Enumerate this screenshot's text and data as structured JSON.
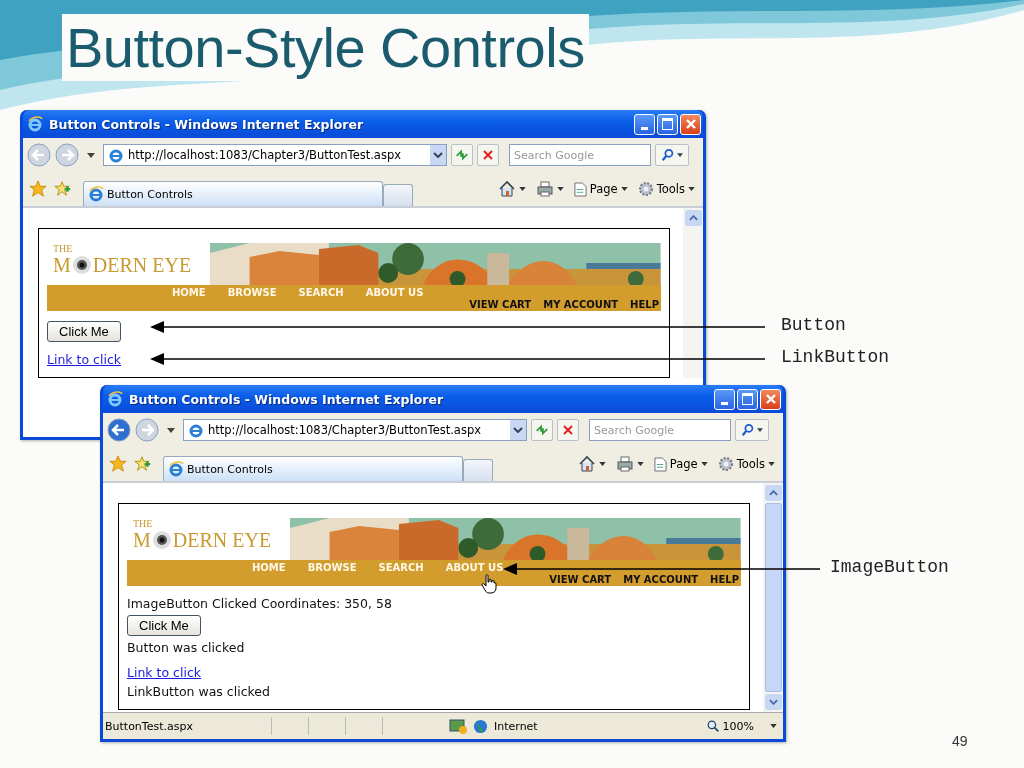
{
  "slide": {
    "title": "Button-Style Controls",
    "page_number": "49"
  },
  "windows": [
    {
      "title": "Button Controls - Windows Internet Explorer",
      "address": "http://localhost:1083/Chapter3/ButtonTest.aspx",
      "search": {
        "placeholder": "Search Google"
      },
      "tab": "Button Controls",
      "commands": [
        "Page",
        "Tools"
      ],
      "back_enabled": false,
      "cursor": false,
      "banner": {
        "logo_top": "THE",
        "logo_parts": [
          "M",
          "DERN EYE"
        ],
        "main_nav": [
          "HOME",
          "BROWSE",
          "SEARCH",
          "ABOUT US"
        ],
        "account_nav": [
          "VIEW CART",
          "MY ACCOUNT",
          "HELP"
        ]
      },
      "content": [
        {
          "kind": "button",
          "text": "Click Me"
        },
        {
          "kind": "link",
          "text": "Link to click"
        }
      ]
    },
    {
      "title": "Button Controls - Windows Internet Explorer",
      "address": "http://localhost:1083/Chapter3/ButtonTest.aspx",
      "search": {
        "placeholder": "Search Google"
      },
      "tab": "Button Controls",
      "commands": [
        "Page",
        "Tools"
      ],
      "back_enabled": true,
      "cursor": true,
      "banner": {
        "logo_top": "THE",
        "logo_parts": [
          "M",
          "DERN EYE"
        ],
        "main_nav": [
          "HOME",
          "BROWSE",
          "SEARCH",
          "ABOUT US"
        ],
        "account_nav": [
          "VIEW CART",
          "MY ACCOUNT",
          "HELP"
        ]
      },
      "content": [
        {
          "kind": "text",
          "text": "ImageButton Clicked Coordinates: 350, 58"
        },
        {
          "kind": "button",
          "text": "Click Me"
        },
        {
          "kind": "text",
          "text": "Button was clicked"
        },
        {
          "kind": "link",
          "text": "Link to click"
        },
        {
          "kind": "text",
          "text": "LinkButton was clicked"
        }
      ],
      "status_bar": {
        "text": "ButtonTest.aspx",
        "zone": "Internet",
        "zoom": "100%"
      }
    }
  ],
  "annotations": [
    {
      "label": "Button"
    },
    {
      "label": "LinkButton"
    },
    {
      "label": "ImageButton"
    }
  ]
}
